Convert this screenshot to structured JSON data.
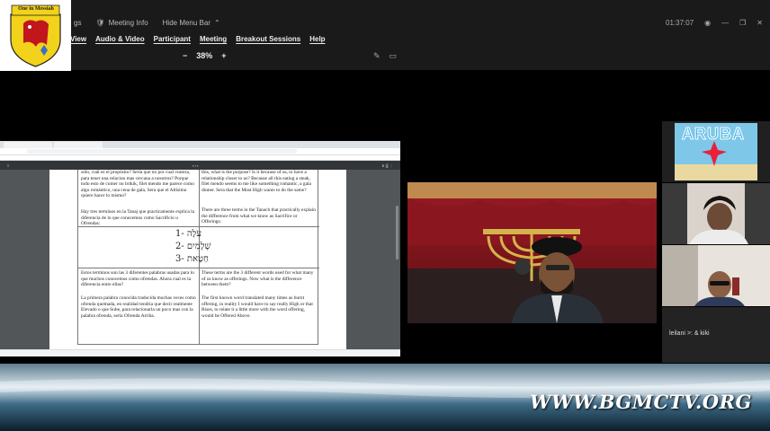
{
  "logo": {
    "text": "One in Messiah"
  },
  "top_bar": {
    "meeting_info_prefix": "gs",
    "meeting_info": "Meeting Info",
    "hide_menu_bar": "Hide Menu Bar",
    "timer": "01:37:07"
  },
  "menu": {
    "items": [
      "View",
      "Audio & Video",
      "Participant",
      "Meeting",
      "Breakout Sessions",
      "Help"
    ]
  },
  "zoom": {
    "minus": "−",
    "level": "38%",
    "plus": "+"
  },
  "pdf": {
    "left_col_top": "sólo, cuál es el propósito? Sería que no por cual vuestra, para tener una relacion mas cercana a nosotros? Porque todo esto de comer no brikik, filet mendo me parece como algo romántico, una cena de gala, Sera que el Altísimo quiere hacer lo mismo?",
    "left_col_terms": "Hay tres terminos en la Tanaj que practicamente explica la diferencia de lo que conocemos como Sacrificio u Ofrendas:",
    "right_col_top": "this, what is the purpose? Is it because of us, to have a relationship closer to us? Because all this eating a steak, filet mendo seems to me like something romantic, a gala dinner. Sera that the Most High wants to do the same?",
    "right_col_terms": "There are three terms in the Tanach that practically explain the difference from what we know as Sacrifice or Offerings:",
    "hebrew_1": "1- עֹלָה",
    "hebrew_2": "2- שְׁלָמִים",
    "hebrew_3": "3- חַטָּאת",
    "left_col_bottom_1": "Estos terminos son las 3 diferentes palabras usadas para lo que muchos conocemos como ofrendas. Ahora cual es la diferencia entre ellas?",
    "left_col_bottom_2": "La primera palabra conocida traducida muchas veces como ofrenda quemada, en realidad tendria que decir realmente Elevado o que Sube, para relacionarla un poco mas con la palabra ofrenda, sería Ofrenda Arriba.",
    "right_col_bottom_1": "These terms are the 3 different words used for what many of us know as offerings. Now what is the difference between them?",
    "right_col_bottom_2": "The first known word translated many times as burnt offering, in reality I would have to say really High or that Rises, to relate it a little more with the word offering, would be Offered Above."
  },
  "participants": {
    "thumb4_name": "leilani >: & kiki",
    "thumb1_sign": "ARUBA"
  },
  "banner": {
    "text": "WWW.BGMCTV.ORG"
  },
  "colors": {
    "topbar": "#1a1a1a",
    "pdf_bg": "#525659",
    "logo_yellow": "#f2d21b",
    "logo_red": "#c0161c"
  }
}
